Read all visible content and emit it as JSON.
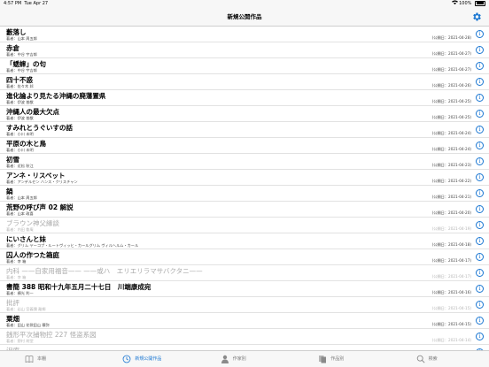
{
  "status": {
    "time": "4:57 PM",
    "date": "Tue Apr 27",
    "battery": "100%"
  },
  "nav": {
    "title": "新規公開作品"
  },
  "rows": [
    {
      "title": "藪落し",
      "author": "著者：山本 周五郎",
      "date": "(公開日：2021-04-28)",
      "dim": false
    },
    {
      "title": "赤倉",
      "author": "著者：中谷 宇吉郎",
      "date": "(公開日：2021-04-27)",
      "dim": false
    },
    {
      "title": "「蟋蟀」の句",
      "author": "著者：中谷 宇吉郎",
      "date": "(公開日：2021-04-27)",
      "dim": false
    },
    {
      "title": "四十不惑",
      "author": "著者：佐々木 邦",
      "date": "(公開日：2021-04-26)",
      "dim": false
    },
    {
      "title": "進化論より見たる沖縄の廃藩置県",
      "author": "著者：伊波 普猷",
      "date": "(公開日：2021-04-25)",
      "dim": false
    },
    {
      "title": "沖縄人の最大欠点",
      "author": "著者：伊波 普猷",
      "date": "(公開日：2021-04-25)",
      "dim": false
    },
    {
      "title": "すみれとうぐいすの話",
      "author": "著者：小川 未明",
      "date": "(公開日：2021-04-24)",
      "dim": false
    },
    {
      "title": "平原の木と鳥",
      "author": "著者：小川 未明",
      "date": "(公開日：2021-04-24)",
      "dim": false
    },
    {
      "title": "初雪",
      "author": "著者：近松 秋江",
      "date": "(公開日：2021-04-23)",
      "dim": false
    },
    {
      "title": "アンネ・リスベット",
      "author": "著者：アンデルセン ハンス・クリスチャン",
      "date": "(公開日：2021-04-22)",
      "dim": false
    },
    {
      "title": "鍋",
      "author": "著者：山本 周五郎",
      "date": "(公開日：2021-04-21)",
      "dim": false
    },
    {
      "title": "荒野の呼び声 02 解説",
      "author": "著者：山本 政喜",
      "date": "(公開日：2021-04-20)",
      "dim": false
    },
    {
      "title": "ブラウン神父縁談",
      "author": "著者：内田 魯庵",
      "date": "(公開日：2021-04-19)",
      "dim": true
    },
    {
      "title": "にいさんと妹",
      "author": "著者：グリム ヤーコプ・ルートヴィッヒ・カールグリム ヴィルヘルム・カール",
      "date": "(公開日：2021-04-18)",
      "dim": false
    },
    {
      "title": "囚人の作つた箱庭",
      "author": "著者：李 箱",
      "date": "(公開日：2021-04-17)",
      "dim": false
    },
    {
      "title": "内科 ——自家用福音—— ——或ハ　エリエリラマサバクタニ——",
      "author": "著者：李 箱",
      "date": "(公開日：2021-04-17)",
      "dim": true
    },
    {
      "title": "書簡 388 昭和十九年五月二十七日　川端康成宛",
      "author": "著者：横光 利一",
      "date": "(公開日：2021-04-16)",
      "dim": false
    },
    {
      "title": "批評",
      "author": "著者：岩山 宮義彌 離郷",
      "date": "(公開日：2021-04-15)",
      "dim": true
    },
    {
      "title": "粟畑",
      "author": "著者：田山 花袋田山 穣弥",
      "date": "(公開日：2021-04-15)",
      "dim": false
    },
    {
      "title": "銭形平次捕物控 227 怪盗系図",
      "author": "著者：野村 胡堂",
      "date": "(公開日：2021-04-14)",
      "dim": true
    },
    {
      "title": "沢庵",
      "author": "",
      "date": "",
      "dim": true
    }
  ],
  "tabs": [
    {
      "label": "本棚",
      "icon": "book-icon",
      "active": false
    },
    {
      "label": "新規公開作品",
      "icon": "clock-icon",
      "active": true
    },
    {
      "label": "作家別",
      "icon": "person-icon",
      "active": false
    },
    {
      "label": "作品別",
      "icon": "documents-icon",
      "active": false
    },
    {
      "label": "検索",
      "icon": "search-icon",
      "active": false
    }
  ],
  "colors": {
    "accent": "#1976d2"
  }
}
